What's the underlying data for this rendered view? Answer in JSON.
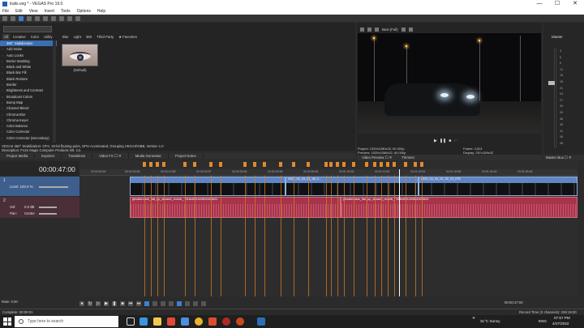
{
  "window": {
    "title": "trails.veg * - VEGAS Pro 19.0",
    "minimize": "—",
    "maximize": "☐",
    "close": "✕"
  },
  "menu": [
    "File",
    "Edit",
    "View",
    "Insert",
    "Tools",
    "Options",
    "Help"
  ],
  "fx": {
    "tabs": [
      "All",
      "Creative",
      "Color",
      "Utility"
    ],
    "tabs2": [
      "Blur",
      "Light",
      "360",
      "Third Party",
      "★ Favorites"
    ],
    "items": [
      "360° Stabilization",
      "Add Noise",
      "Auto Looks",
      "Bezier Masking",
      "Black and White",
      "Black Bar Fill",
      "Black Restore",
      "Border",
      "Brightness and Contrast",
      "Broadcast Colors",
      "Bump Map",
      "Channel Blend",
      "Chroma Blur",
      "Chroma Keyer",
      "Color Balance",
      "Color Corrector",
      "Color Corrector (Secondary)"
    ],
    "selected_index": 0,
    "preset_label": "(Default)",
    "description_line1": "VEGAS 360° Stabilization: OFX, 32-bit floating point, GPU Accelerated, Grouping VEGAS\\OBB, Version 1.0",
    "description_line2": "Description: From Magix Computer Products Intl. Co."
  },
  "panel_tabs": [
    "Project Media",
    "Explorer",
    "Transitions",
    "Video FX ☐ ✕",
    "Media Generator",
    "Project Notes"
  ],
  "preview": {
    "quality": "Best (Full)",
    "project": "Project:  1920x1080x32, 60.000p",
    "preview": "Preview:  1920x1080x32, 60.000p",
    "frame": "Frame:    2,821",
    "display": "Display:  297x159x32",
    "tabs": [
      "Video Preview ☐ ✕",
      "Trimmer"
    ]
  },
  "master": {
    "title": "Master",
    "tab": "Master Bus ☐ ✕",
    "scale": [
      "3",
      "6",
      "9",
      "12",
      "15",
      "18",
      "21",
      "24",
      "27",
      "30",
      "33",
      "36",
      "39",
      "42",
      "45",
      "48"
    ]
  },
  "timeline": {
    "timecode": "00:00:47:00",
    "ruler_ticks": [
      "00:00:00:00",
      "00:00:09:59",
      "00:00:19:58",
      "00:00:29:57",
      "00:00:39:56",
      "00:00:49:55",
      "00:00:59:54",
      "00:01:09:53",
      "00:01:19:52",
      "00:01:29:51",
      "00:01:39:50",
      "00:01:49:49",
      "00:01:59:48"
    ],
    "video_track": {
      "level": "Level: 100.0 %"
    },
    "audio_track": {
      "vol": "Vol:",
      "vol_value": "0.0 dB",
      "pan": "Pan:",
      "pan_value": "Center"
    },
    "video_clips": [
      {
        "name": ""
      },
      {
        "name": "2022_04_04_01_46_1..."
      },
      {
        "name": "2022_04_04_02_32_13_076"
      }
    ],
    "audio_clips": [
      {
        "name": "ghostemane_flat_up_slowed_reverb_~918x599149602026622"
      },
      {
        "name": "ghostemane_flat_up_slowed_reverb_~918x599149602026622"
      }
    ]
  },
  "bottom": {
    "rate": "Rate: 0.00",
    "time": "00:00:47:00",
    "complete": "Complete: 00:00:01",
    "record_time": "Record Time (2 channels): 226:19:20"
  },
  "taskbar": {
    "search_placeholder": "Type here to search",
    "weather": "31°C  Sunny",
    "lang": "ENG",
    "time": "07:57 PM",
    "date": "4/27/2022"
  },
  "colors": {
    "accent": "#3f7fd1",
    "video_clip": "#5f86c4",
    "audio_clip": "#a8334a",
    "marker": "#e08a2c"
  }
}
